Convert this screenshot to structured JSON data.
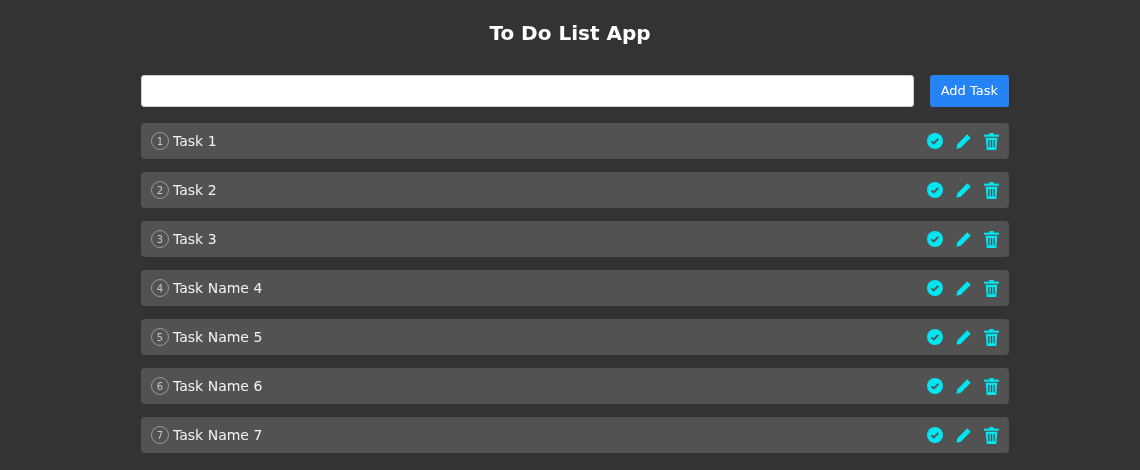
{
  "title": "To Do List App",
  "add_button": "Add Task",
  "tasks": [
    {
      "number": "1",
      "label": "Task 1"
    },
    {
      "number": "2",
      "label": "Task 2"
    },
    {
      "number": "3",
      "label": "Task 3"
    },
    {
      "number": "4",
      "label": "Task Name 4"
    },
    {
      "number": "5",
      "label": "Task Name 5"
    },
    {
      "number": "6",
      "label": "Task Name 6"
    },
    {
      "number": "7",
      "label": "Task Name 7"
    }
  ]
}
